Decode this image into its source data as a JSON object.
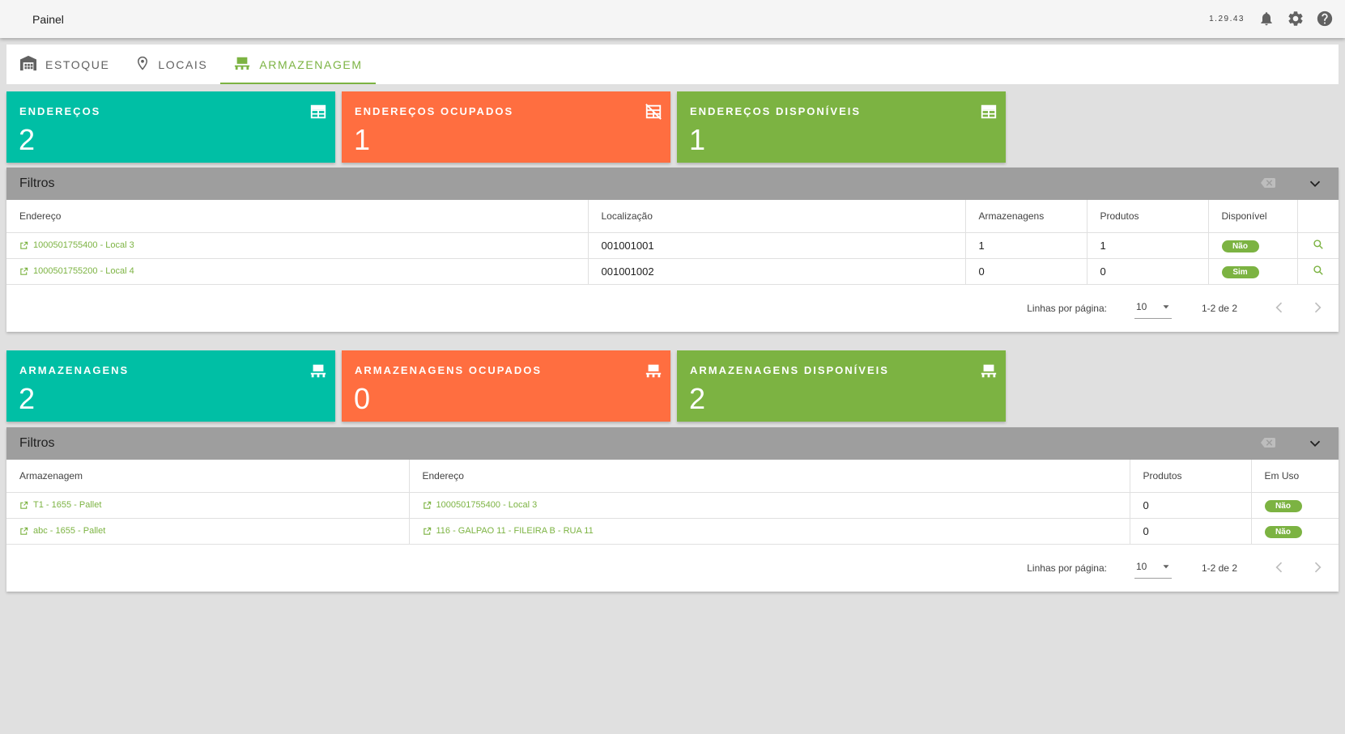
{
  "topbar": {
    "title": "Painel",
    "version": "1.29.43",
    "icons": [
      "bell-icon",
      "gear-icon",
      "help-icon"
    ]
  },
  "tabs": [
    {
      "label": "ESTOQUE",
      "icon": "warehouse-icon",
      "active": false
    },
    {
      "label": "LOCAIS",
      "icon": "location-pin-icon",
      "active": false
    },
    {
      "label": "ARMAZENAGEM",
      "icon": "pallet-icon",
      "active": true
    }
  ],
  "address_cards": [
    {
      "label": "ENDEREÇOS",
      "value": "2",
      "icon": "grid-icon",
      "color": "#00bfa5"
    },
    {
      "label": "ENDEREÇOS OCUPADOS",
      "value": "1",
      "icon": "grid-off-icon",
      "color": "#ff6e40"
    },
    {
      "label": "ENDEREÇOS DISPONÍVEIS",
      "value": "1",
      "icon": "grid-icon",
      "color": "#7cb342"
    }
  ],
  "address_panel": {
    "filter_title": "Filtros",
    "columns": [
      "Endereço",
      "Localização",
      "Armazenagens",
      "Produtos",
      "Disponível",
      ""
    ],
    "rows": [
      {
        "endereco": "1000501755400 - Local 3",
        "localizacao": "001001001",
        "armazenagens": "1",
        "produtos": "1",
        "disponivel": "Não"
      },
      {
        "endereco": "1000501755200 - Local 4",
        "localizacao": "001001002",
        "armazenagens": "0",
        "produtos": "0",
        "disponivel": "Sim"
      }
    ],
    "footer": {
      "rows_per_page_label": "Linhas por página:",
      "rows_per_page": "10",
      "range": "1-2 de 2"
    }
  },
  "storage_cards": [
    {
      "label": "ARMAZENAGENS",
      "value": "2",
      "icon": "pallet-icon",
      "color": "#00bfa5"
    },
    {
      "label": "ARMAZENAGENS OCUPADOS",
      "value": "0",
      "icon": "pallet-icon",
      "color": "#ff6e40"
    },
    {
      "label": "ARMAZENAGENS DISPONÍVEIS",
      "value": "2",
      "icon": "pallet-icon",
      "color": "#7cb342"
    }
  ],
  "storage_panel": {
    "filter_title": "Filtros",
    "columns": [
      "Armazenagem",
      "Endereço",
      "Produtos",
      "Em Uso"
    ],
    "rows": [
      {
        "armazenagem": "T1 - 1655 - Pallet",
        "endereco": "1000501755400 - Local 3",
        "produtos": "0",
        "em_uso": "Não"
      },
      {
        "armazenagem": "abc - 1655 - Pallet",
        "endereco": "116 - GALPAO 11 - FILEIRA B - RUA 11",
        "produtos": "0",
        "em_uso": "Não"
      }
    ],
    "footer": {
      "rows_per_page_label": "Linhas por página:",
      "rows_per_page": "10",
      "range": "1-2 de 2"
    }
  }
}
